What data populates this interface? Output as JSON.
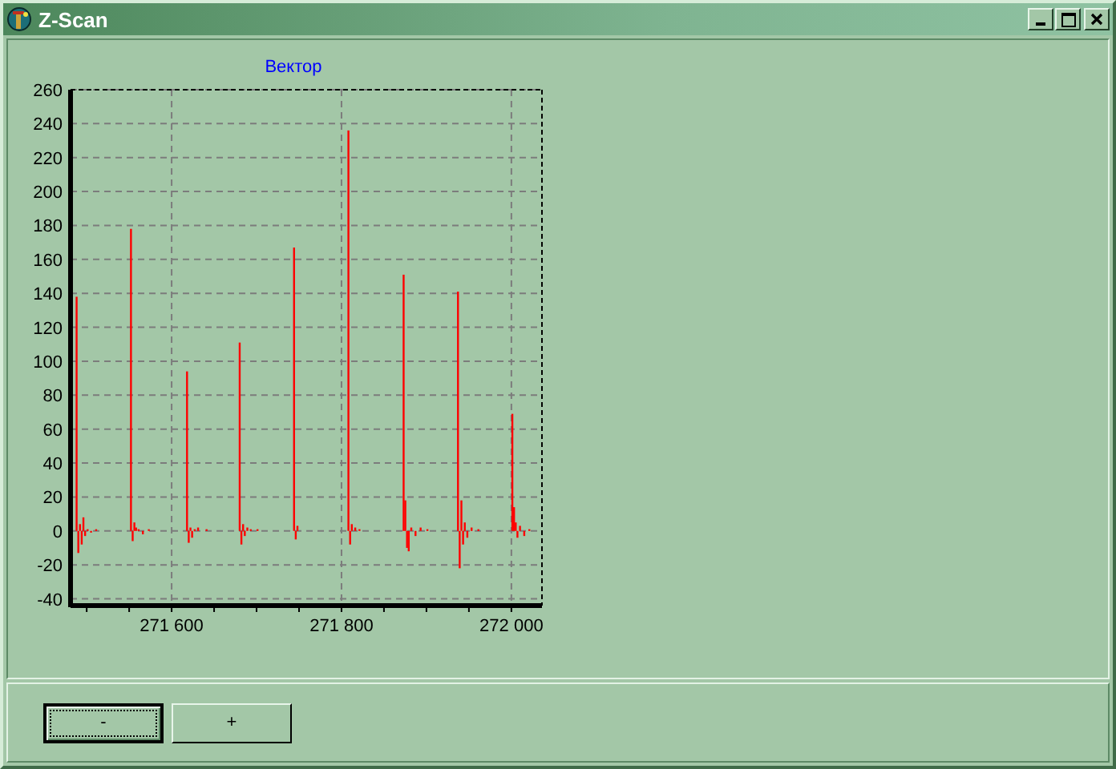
{
  "window": {
    "title": "Z-Scan"
  },
  "chart": {
    "chart_data": {
      "type": "bar",
      "grid": true,
      "title": "Вектор",
      "xlim": [
        271481,
        272036
      ],
      "ylim": [
        -44,
        260
      ],
      "yticks": [
        -40,
        -20,
        0,
        20,
        40,
        60,
        80,
        100,
        120,
        140,
        160,
        180,
        200,
        220,
        240,
        260
      ],
      "xticks": [
        {
          "value": 271600,
          "label": "271 600"
        },
        {
          "value": 271800,
          "label": "271 800"
        },
        {
          "value": 272000,
          "label": "272 000"
        }
      ],
      "x": [
        271487,
        271489,
        271491,
        271493,
        271495,
        271497,
        271500,
        271504,
        271510,
        271551,
        271553,
        271555,
        271557,
        271560,
        271565,
        271572,
        271617,
        271619,
        271621,
        271623,
        271626,
        271630,
        271640,
        271679,
        271681,
        271683,
        271685,
        271688,
        271692,
        271700,
        271743,
        271745,
        271747,
        271807,
        271809,
        271811,
        271815,
        271820,
        271872,
        271874,
        271876,
        271878,
        271881,
        271886,
        271892,
        271900,
        271936,
        271938,
        271940,
        271942,
        271944,
        271947,
        271952,
        271960,
        272000,
        272002,
        272004,
        272006,
        272009,
        272014,
        272020
      ],
      "series": [
        {
          "color": "#ff0000",
          "values": [
            138,
            -13,
            4,
            -8,
            8,
            -3,
            1,
            -1,
            1,
            178,
            -6,
            5,
            2,
            1,
            -2,
            1,
            94,
            -7,
            2,
            -4,
            1,
            2,
            1,
            111,
            -8,
            4,
            -3,
            2,
            1,
            1,
            167,
            -5,
            3,
            236,
            -8,
            4,
            2,
            1,
            151,
            18,
            -10,
            -12,
            2,
            -3,
            2,
            1,
            141,
            -22,
            18,
            -8,
            5,
            -4,
            2,
            1,
            69,
            14,
            5,
            -4,
            3,
            -3,
            1
          ]
        }
      ]
    }
  },
  "buttons": [
    {
      "label": "-",
      "focused": true
    },
    {
      "label": "+",
      "focused": false
    }
  ]
}
